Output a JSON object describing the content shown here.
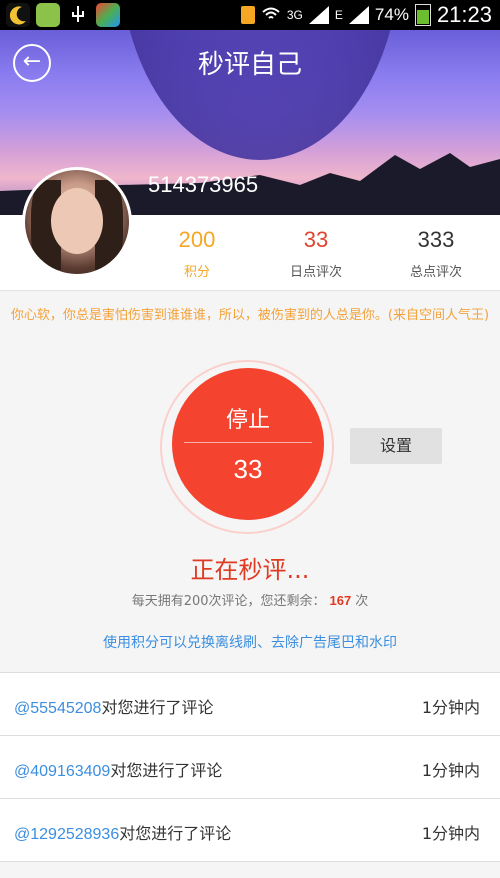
{
  "status_bar": {
    "network": "3G",
    "signal_label": "E",
    "battery": "74%",
    "time": "21:23"
  },
  "header": {
    "title": "秒评自己",
    "user_id": "514373965"
  },
  "stats": [
    {
      "value": "200",
      "label": "积分",
      "color": "#f5a623"
    },
    {
      "value": "33",
      "label": "日点评次",
      "color": "#e0432e"
    },
    {
      "value": "333",
      "label": "总点评次",
      "color": "#333333"
    }
  ],
  "motto": "你心软，你总是害怕伤害到谁谁谁，所以，被伤害到的人总是你。(来自空间人气王)",
  "action": {
    "stop_label": "停止",
    "count": "33",
    "settings_label": "设置"
  },
  "status_text": "正在秒评...",
  "remaining": {
    "prefix": "每天拥有200次评论，您还剩余：",
    "value": "167",
    "suffix": "次"
  },
  "promo": "使用积分可以兑换离线刷、去除广告尾巴和水印",
  "comments": [
    {
      "uid": "@55545208",
      "text": "对您进行了评论",
      "time": "1分钟内"
    },
    {
      "uid": "@409163409",
      "text": "对您进行了评论",
      "time": "1分钟内"
    },
    {
      "uid": "@1292528936",
      "text": "对您进行了评论",
      "time": "1分钟内"
    }
  ],
  "icons": [
    "moon-icon",
    "app-icon",
    "usb-icon",
    "browser-icon",
    "sim-icon",
    "wifi-icon",
    "signal-icon",
    "battery-icon",
    "back-arrow-icon"
  ]
}
